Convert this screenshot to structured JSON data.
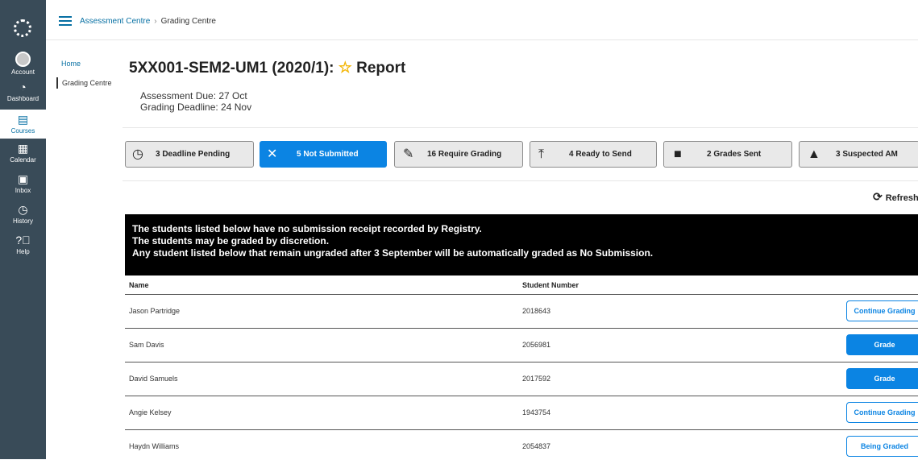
{
  "rail": {
    "items": [
      {
        "label": "Account",
        "icon": "avatar-icon"
      },
      {
        "label": "Dashboard",
        "icon": "dashboard-icon"
      },
      {
        "label": "Courses",
        "icon": "courses-icon"
      },
      {
        "label": "Calendar",
        "icon": "calendar-icon"
      },
      {
        "label": "Inbox",
        "icon": "inbox-icon"
      },
      {
        "label": "History",
        "icon": "history-icon"
      },
      {
        "label": "Help",
        "icon": "help-icon"
      }
    ]
  },
  "breadcrumb": {
    "parent": "Assessment Centre",
    "sep": "›",
    "current": "Grading Centre"
  },
  "subnav": {
    "home": "Home",
    "active": "Grading Centre"
  },
  "page": {
    "title": "5XX001-SEM2-UM1 (2020/1):",
    "title_suffix": "Report",
    "star": "☆",
    "due": "Assessment Due: 27 Oct",
    "deadline": "Grading Deadline: 24 Nov"
  },
  "tabs": [
    {
      "label": "3 Deadline Pending",
      "icon": "clock-icon"
    },
    {
      "label": "5 Not Submitted",
      "icon": "x-icon"
    },
    {
      "label": "16 Require Grading",
      "icon": "pencil-icon"
    },
    {
      "label": "4 Ready to Send",
      "icon": "upload-icon"
    },
    {
      "label": "2 Grades Sent",
      "icon": "lock-icon"
    },
    {
      "label": "3 Suspected AM",
      "icon": "warning-icon"
    }
  ],
  "refresh_label": "Refresh",
  "banner": [
    "The students listed below have no submission receipt recorded by Registry.",
    "The students may be graded by discretion.",
    "Any student listed below that remain ungraded after 3 September will be automatically graded as No Submission."
  ],
  "table": {
    "headers": {
      "name": "Name",
      "number": "Student Number"
    },
    "rows": [
      {
        "name": "Jason Partridge",
        "number": "2018643",
        "action": "Continue Grading"
      },
      {
        "name": "Sam Davis",
        "number": "2056981",
        "action": "Grade"
      },
      {
        "name": "David Samuels",
        "number": "2017592",
        "action": "Grade"
      },
      {
        "name": "Angie Kelsey",
        "number": "1943754",
        "action": "Continue Grading"
      },
      {
        "name": "Haydn Williams",
        "number": "2054837",
        "action": "Being Graded"
      }
    ]
  },
  "colors": {
    "rail": "#394b58",
    "link": "#0770a3",
    "accent": "#0b84e3",
    "star": "#f3b400"
  }
}
